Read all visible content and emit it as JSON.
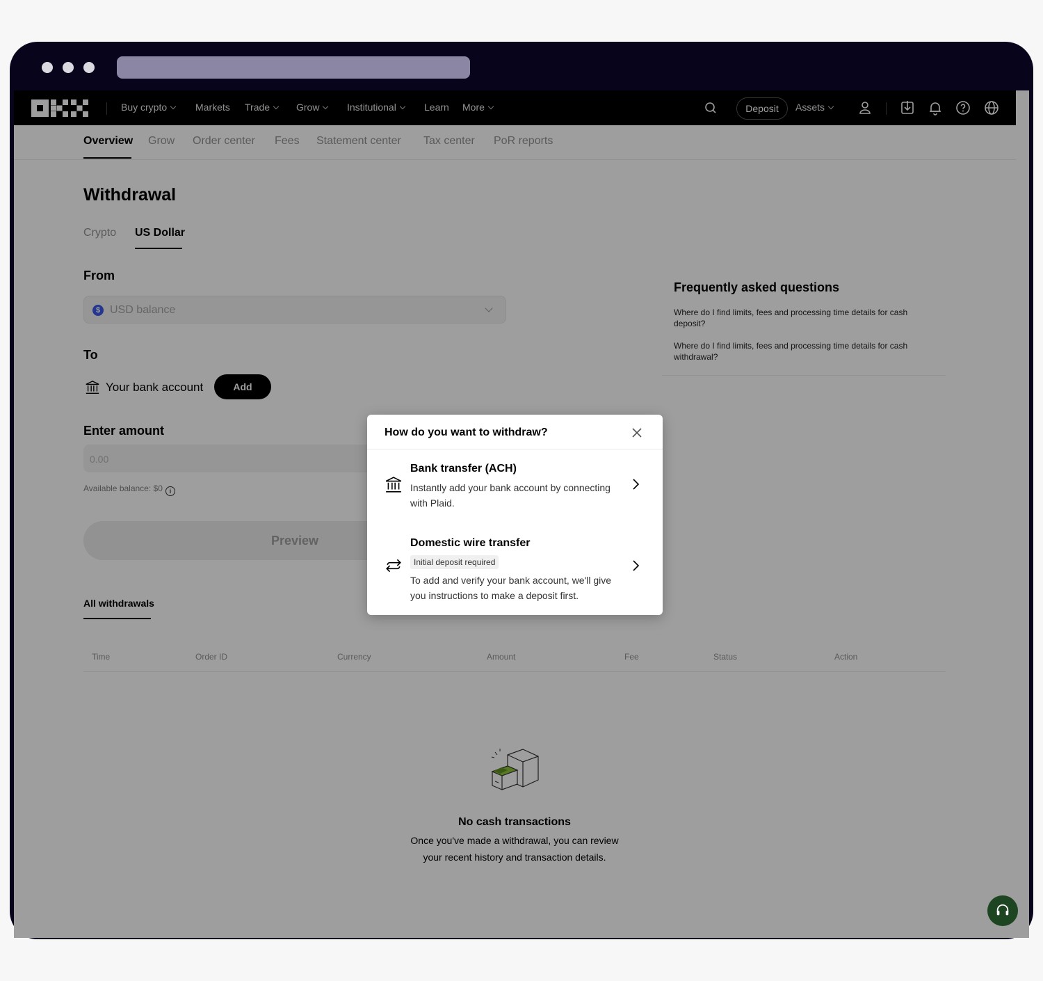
{
  "nav": {
    "items": [
      {
        "label": "Buy crypto",
        "dropdown": true
      },
      {
        "label": "Markets",
        "dropdown": false
      },
      {
        "label": "Trade",
        "dropdown": true
      },
      {
        "label": "Grow",
        "dropdown": true
      },
      {
        "label": "Institutional",
        "dropdown": true
      },
      {
        "label": "Learn",
        "dropdown": false
      },
      {
        "label": "More",
        "dropdown": true
      }
    ],
    "deposit_label": "Deposit",
    "assets_label": "Assets",
    "icons": [
      "search-icon",
      "user-icon",
      "download-icon",
      "bell-icon",
      "help-icon",
      "globe-icon"
    ]
  },
  "subnav": {
    "items": [
      "Overview",
      "Grow",
      "Order center",
      "Fees",
      "Statement center",
      "Tax center",
      "PoR reports"
    ],
    "active": "Overview"
  },
  "page": {
    "title": "Withdrawal",
    "tabs": [
      "Crypto",
      "US Dollar"
    ],
    "active_tab": "US Dollar",
    "from_label": "From",
    "from_select": "USD balance",
    "currency_badge": "$",
    "to_label": "To",
    "bank_account": "Your bank account",
    "add_button": "Add",
    "amount_label": "Enter amount",
    "amount_placeholder": "0.00",
    "available_balance": "Available balance: $0",
    "info_glyph": "i",
    "preview_button": "Preview"
  },
  "history": {
    "tab": "All withdrawals",
    "columns": [
      "Time",
      "Order ID",
      "Currency",
      "Amount",
      "Fee",
      "Status",
      "Action"
    ],
    "empty_title": "No cash transactions",
    "empty_desc_line1": "Once you've made a withdrawal, you can review",
    "empty_desc_line2": "your recent history and transaction details."
  },
  "faq": {
    "title": "Frequently asked questions",
    "questions": [
      "Where do I find limits, fees and processing time details for cash deposit?",
      "Where do I find limits, fees and processing time details for cash withdrawal?"
    ]
  },
  "modal": {
    "title": "How do you want to withdraw?",
    "options": [
      {
        "title": "Bank transfer (ACH)",
        "desc": "Instantly add your bank account by connecting with Plaid.",
        "icon": "bank-icon"
      },
      {
        "title": "Domestic wire transfer",
        "tag": "Initial deposit required",
        "desc": "To add and verify your bank account, we'll give you instructions to make a deposit first.",
        "icon": "transfer-icon"
      }
    ]
  },
  "colors": {
    "accent": "#000000",
    "frame": "#07041c",
    "currency_badge": "#3a57e8",
    "chat_button": "#1e4522"
  }
}
